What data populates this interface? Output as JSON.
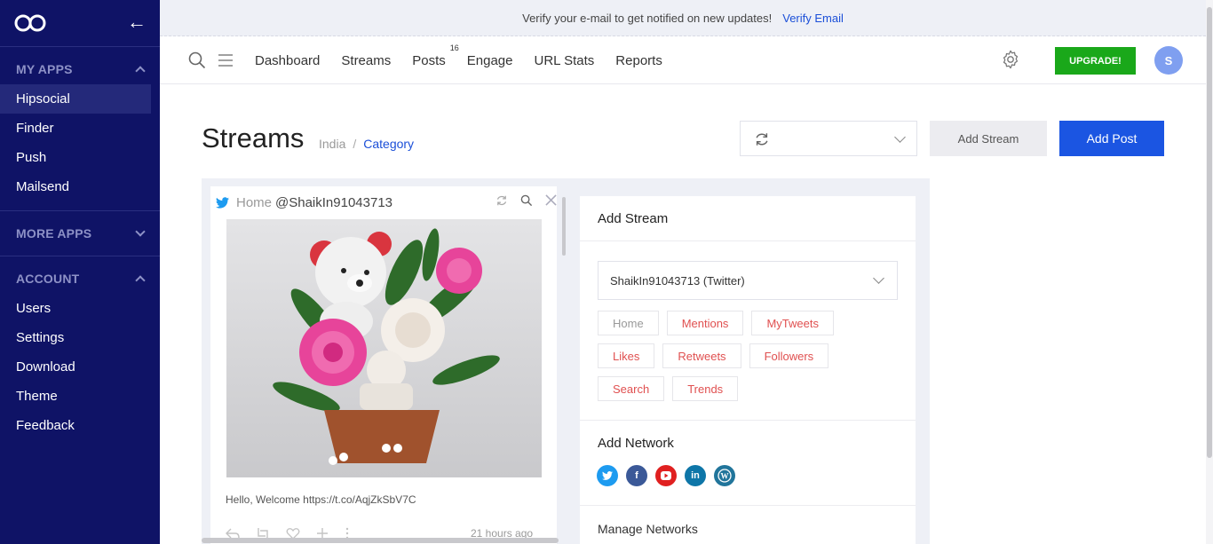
{
  "sidebar": {
    "sections": [
      {
        "title": "MY APPS",
        "expanded": true,
        "items": [
          "Hipsocial",
          "Finder",
          "Push",
          "Mailsend"
        ],
        "active": "Hipsocial"
      },
      {
        "title": "MORE APPS",
        "expanded": false,
        "items": []
      },
      {
        "title": "ACCOUNT",
        "expanded": true,
        "items": [
          "Users",
          "Settings",
          "Download",
          "Theme",
          "Feedback"
        ]
      }
    ]
  },
  "notice": {
    "text": "Verify your e-mail to get notified on new updates!",
    "link": "Verify Email"
  },
  "nav": {
    "links": [
      "Dashboard",
      "Streams",
      "Posts",
      "Engage",
      "URL Stats",
      "Reports"
    ],
    "posts_badge": "16",
    "upgrade_label": "UPGRADE!",
    "avatar_initial": "S"
  },
  "page": {
    "title": "Streams",
    "breadcrumb": [
      "India",
      "Category"
    ],
    "add_stream_label": "Add Stream",
    "add_post_label": "Add Post"
  },
  "stream": {
    "label": "Home",
    "handle": "@ShaikIn91043713",
    "post_text": "Hello, Welcome https://t.co/AqjZkSbV7C",
    "time": "21 hours ago"
  },
  "panel": {
    "title": "Add Stream",
    "account": "ShaikIn91043713 (Twitter)",
    "chips": [
      [
        "Home",
        "Mentions",
        "MyTweets"
      ],
      [
        "Likes",
        "Retweets",
        "Followers"
      ],
      [
        "Search",
        "Trends"
      ]
    ],
    "network_title": "Add Network",
    "networks": [
      {
        "name": "twitter-icon",
        "color": "#1d9bf0"
      },
      {
        "name": "facebook-icon",
        "color": "#3b5998"
      },
      {
        "name": "youtube-icon",
        "color": "#e02020"
      },
      {
        "name": "linkedin-icon",
        "color": "#0e76a8"
      },
      {
        "name": "wordpress-icon",
        "color": "#21759b"
      }
    ],
    "manage_label": "Manage Networks"
  }
}
